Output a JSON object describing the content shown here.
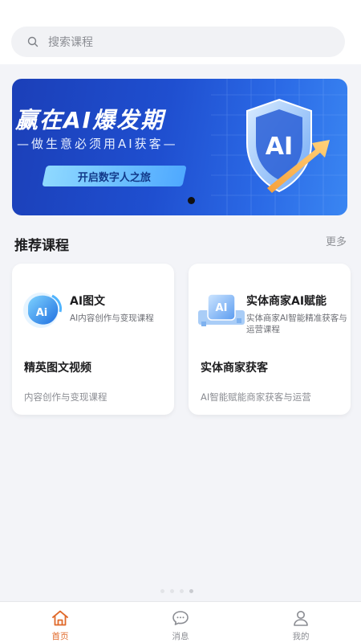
{
  "search": {
    "placeholder": "搜索课程"
  },
  "banner": {
    "title": "赢在AI爆发期",
    "subtitle": "—做生意必须用AI获客—",
    "button": "开启数字人之旅",
    "badge": "AI"
  },
  "recommend": {
    "title": "推荐课程",
    "more": "更多",
    "cards": [
      {
        "name": "AI图文",
        "desc": "AI内容创作与变现课程",
        "main": "精英图文视频",
        "sub": "内容创作与变现课程",
        "logo_text": "Ai"
      },
      {
        "name": "实体商家AI赋能",
        "desc": "实体商家AI智能精准获客与运营课程",
        "main": "实体商家获客",
        "sub": "AI智能赋能商家获客与运营",
        "logo_text": "AI"
      }
    ]
  },
  "tabbar": {
    "tabs": [
      {
        "label": "首页",
        "icon": "home-icon",
        "active": true
      },
      {
        "label": "消息",
        "icon": "chat-icon",
        "active": false
      },
      {
        "label": "我的",
        "icon": "user-icon",
        "active": false
      }
    ]
  },
  "colors": {
    "accent": "#e0692a",
    "banner_blue": "#1f4fd0",
    "background": "#f3f4f8"
  }
}
